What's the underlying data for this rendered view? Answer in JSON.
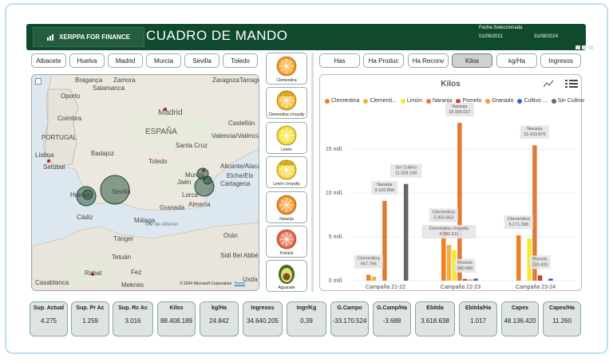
{
  "header": {
    "logo": "XERPPA FOR FINANCE",
    "title": "CUADRO DE MANDO",
    "fecha_label": "Fecha Seleccionada",
    "fecha_desde": "01/09/2021",
    "fecha_hasta": "31/08/2024"
  },
  "cities": [
    "Albacete",
    "Huelva",
    "Madrid",
    "Murcia",
    "Sevilla",
    "Toledo"
  ],
  "metrics": [
    "Has",
    "Ha Produc",
    "Ha Reconv",
    "Kilos",
    "kg/Ha",
    "Ingresos"
  ],
  "active_metric": "Kilos",
  "map": {
    "labels": [
      {
        "t": "Oporto"
      },
      {
        "t": "Coimbra"
      },
      {
        "t": "Madrid"
      },
      {
        "t": "ESPAÑA"
      },
      {
        "t": "Valencia/València"
      },
      {
        "t": "PORTUGAL"
      },
      {
        "t": "Lisboa"
      },
      {
        "t": "Setúbal"
      },
      {
        "t": "Badajoz"
      },
      {
        "t": "Toledo"
      },
      {
        "t": "Murcia"
      },
      {
        "t": "Elche/Elx"
      },
      {
        "t": "Alicante/Alacant"
      },
      {
        "t": "Cartagena"
      },
      {
        "t": "Sevilla"
      },
      {
        "t": "Jaén"
      },
      {
        "t": "Almería"
      },
      {
        "t": "Mar de Alborán"
      },
      {
        "t": "Tánger"
      },
      {
        "t": "Rabat"
      },
      {
        "t": "Fez"
      },
      {
        "t": "Casablanca"
      },
      {
        "t": "Meknès"
      },
      {
        "t": "Sidi Bel Abbès"
      },
      {
        "t": "Orán"
      },
      {
        "t": "Uxda"
      },
      {
        "t": "Tetuán"
      },
      {
        "t": "Salamanca"
      },
      {
        "t": "Zamora"
      },
      {
        "t": "Bragança"
      },
      {
        "t": "Zaragoza"
      },
      {
        "t": "Tarragona"
      },
      {
        "t": "Castellón"
      },
      {
        "t": "Granada"
      },
      {
        "t": "Huelva"
      },
      {
        "t": "Santa Cruz"
      },
      {
        "t": "Lorca"
      },
      {
        "t": "Cádiz"
      },
      {
        "t": "Málaga"
      }
    ],
    "copyright": "© 2024 Microsoft Corporation",
    "terms": "Terms"
  },
  "fruits": [
    {
      "label": "Clementina",
      "color": "#f39a1e"
    },
    {
      "label": "Clementina c/royalty",
      "color": "#f6b62a"
    },
    {
      "label": "Limón",
      "color": "#f5de2a"
    },
    {
      "label": "Limón c/royalty",
      "color": "#f5d833"
    },
    {
      "label": "Naranja",
      "color": "#f28a1d"
    },
    {
      "label": "Pomelo",
      "color": "#e45c47"
    },
    {
      "label": "Aguacate",
      "color": "#5d7a2a"
    }
  ],
  "kpis": [
    {
      "k": "Sup. Actual",
      "v": "4.275"
    },
    {
      "k": "Sup. Pr Ac",
      "v": "1.259"
    },
    {
      "k": "Sup. Rc Ac",
      "v": "3.016"
    },
    {
      "k": "Kilos",
      "v": "88.408.189"
    },
    {
      "k": "kg/Ha",
      "v": "24.842"
    },
    {
      "k": "Ingresos",
      "v": "34.640.205"
    },
    {
      "k": "Ingr/Kg",
      "v": "0,39"
    },
    {
      "k": "G.Campo",
      "v": "-33.170.524"
    },
    {
      "k": "G.Camp/Ha",
      "v": "-3.688"
    },
    {
      "k": "Ebitda",
      "v": "3.618.638"
    },
    {
      "k": "Ebitda/Ha",
      "v": "1.017"
    },
    {
      "k": "Capex",
      "v": "48.136.420"
    },
    {
      "k": "Capex/Ha",
      "v": "11.260"
    }
  ],
  "chart_data": {
    "type": "bar",
    "title": "Kilos",
    "categories": [
      "Campaña 21-22",
      "Campaña 22-23",
      "Campaña 23-24"
    ],
    "yticks": [
      "0 mill.",
      "5 mill.",
      "10 mill.",
      "15 mill."
    ],
    "ylim": [
      0,
      18000000
    ],
    "legend_position": "top",
    "series": [
      {
        "name": "Clementina",
        "color": "#f07f22",
        "values": [
          667766,
          5950853,
          5171308
        ]
      },
      {
        "name": "Clementi...",
        "color": "#f5b042",
        "values": [
          450000,
          4082611,
          null
        ]
      },
      {
        "name": "Limón",
        "color": "#f5e82a",
        "values": [
          null,
          3500000,
          4800000
        ]
      },
      {
        "name": "Naranja",
        "color": "#e07a39",
        "values": [
          9100856,
          18000027,
          15433879
        ]
      },
      {
        "name": "Pomelo",
        "color": "#c9452d",
        "values": [
          null,
          200000,
          600000
        ]
      },
      {
        "name": "Granado",
        "color": "#f29a3a",
        "values": [
          null,
          140000,
          null
        ]
      },
      {
        "name": "Cultivo ...",
        "color": "#2f63d8",
        "values": [
          null,
          240080,
          230420
        ]
      },
      {
        "name": "Sin Cultivo",
        "color": "#666666",
        "values": [
          11028168,
          null,
          null
        ]
      }
    ],
    "data_labels": [
      {
        "series": "Clementina",
        "cat": 0,
        "text": "Clementina\n667.766"
      },
      {
        "series": "Naranja",
        "cat": 0,
        "text": "Naranja\n9.100.856"
      },
      {
        "series": "Sin Cultivo",
        "cat": 0,
        "text": "Sin Cultivo\n11.028.168"
      },
      {
        "series": "Clementina",
        "cat": 1,
        "text": "Clementina\n5.950.853"
      },
      {
        "series": "Clementi...",
        "cat": 1,
        "text": "Clementina c/royalty\n4.082.611"
      },
      {
        "series": "Naranja",
        "cat": 1,
        "text": "Naranja\n18.000.027"
      },
      {
        "series": "Pomelo",
        "cat": 1,
        "text": "Pomelo\n240.080"
      },
      {
        "series": "Clementina",
        "cat": 2,
        "text": "Clementina\n5.171.308"
      },
      {
        "series": "Naranja",
        "cat": 2,
        "text": "Naranja\n15.433.879"
      },
      {
        "series": "Pomelo",
        "cat": 2,
        "text": "Pomelo\n230.420"
      }
    ]
  }
}
